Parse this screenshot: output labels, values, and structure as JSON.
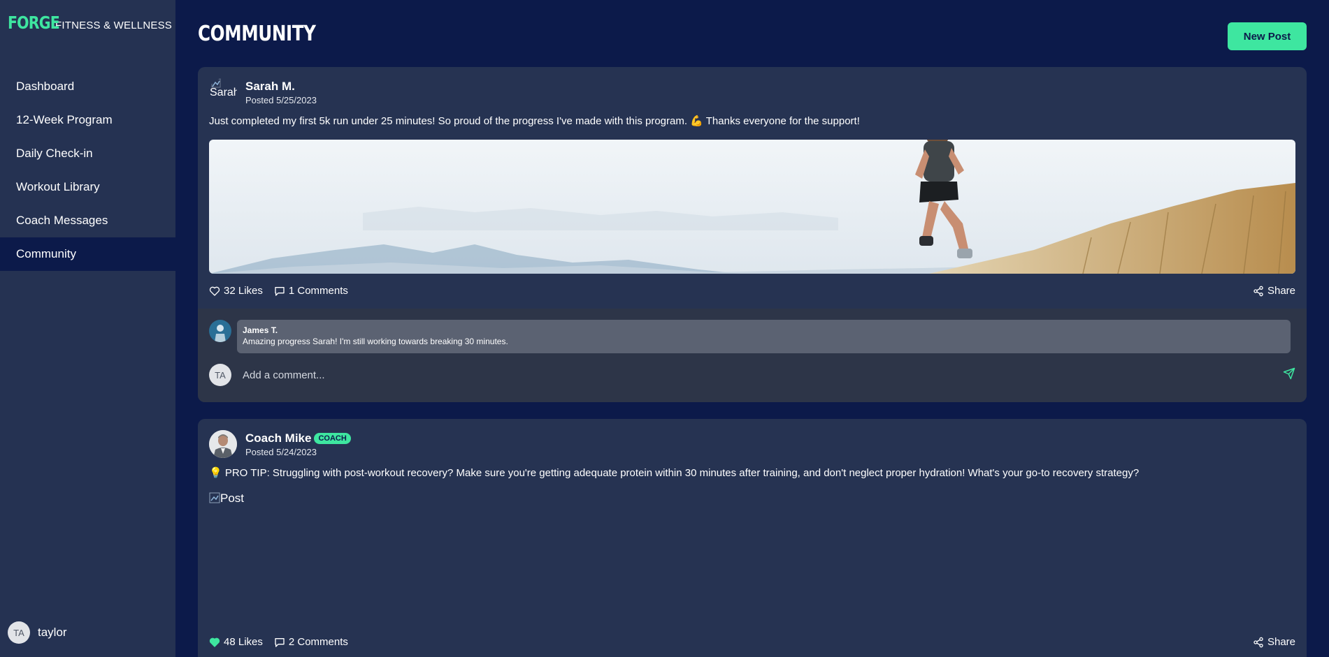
{
  "brand": {
    "logo": "FORGE",
    "tagline": "FITNESS & WELLNESS"
  },
  "nav": {
    "items": [
      {
        "label": "Dashboard",
        "active": false
      },
      {
        "label": "12-Week Program",
        "active": false
      },
      {
        "label": "Daily Check-in",
        "active": false
      },
      {
        "label": "Workout Library",
        "active": false
      },
      {
        "label": "Coach Messages",
        "active": false
      },
      {
        "label": "Community",
        "active": true
      }
    ]
  },
  "user": {
    "initials": "TA",
    "name": "taylor"
  },
  "page": {
    "title": "COMMUNITY",
    "new_post_label": "New Post"
  },
  "posts": [
    {
      "author": "Sarah M.",
      "avatar_alt": "Sarah",
      "posted": "Posted 5/25/2023",
      "body": "Just completed my first 5k run under 25 minutes! So proud of the progress I've made with this program. 💪 Thanks everyone for the support!",
      "likes": "32 Likes",
      "liked": false,
      "comments": "1 Comments",
      "share": "Share",
      "comment_list": [
        {
          "author": "James T.",
          "text": "Amazing progress Sarah! I'm still working towards breaking 30 minutes."
        }
      ],
      "comment_placeholder": "Add a comment...",
      "commenter_initials": "TA"
    },
    {
      "author": "Coach Mike",
      "badge": "COACH",
      "posted": "Posted 5/24/2023",
      "body": "💡 PRO TIP: Struggling with post-workout recovery? Make sure you're getting adequate protein within 30 minutes after training, and don't neglect proper hydration! What's your go-to recovery strategy?",
      "image_alt": "Post",
      "likes": "48 Likes",
      "liked": true,
      "comments": "2 Comments",
      "share": "Share"
    }
  ],
  "colors": {
    "accent": "#3ee6a0",
    "background": "#0c1a4a",
    "sidebar": "#253252",
    "card": "#263352"
  },
  "icons": {
    "like": "heart-icon",
    "comment": "comment-icon",
    "share": "share-icon",
    "send": "send-icon"
  }
}
